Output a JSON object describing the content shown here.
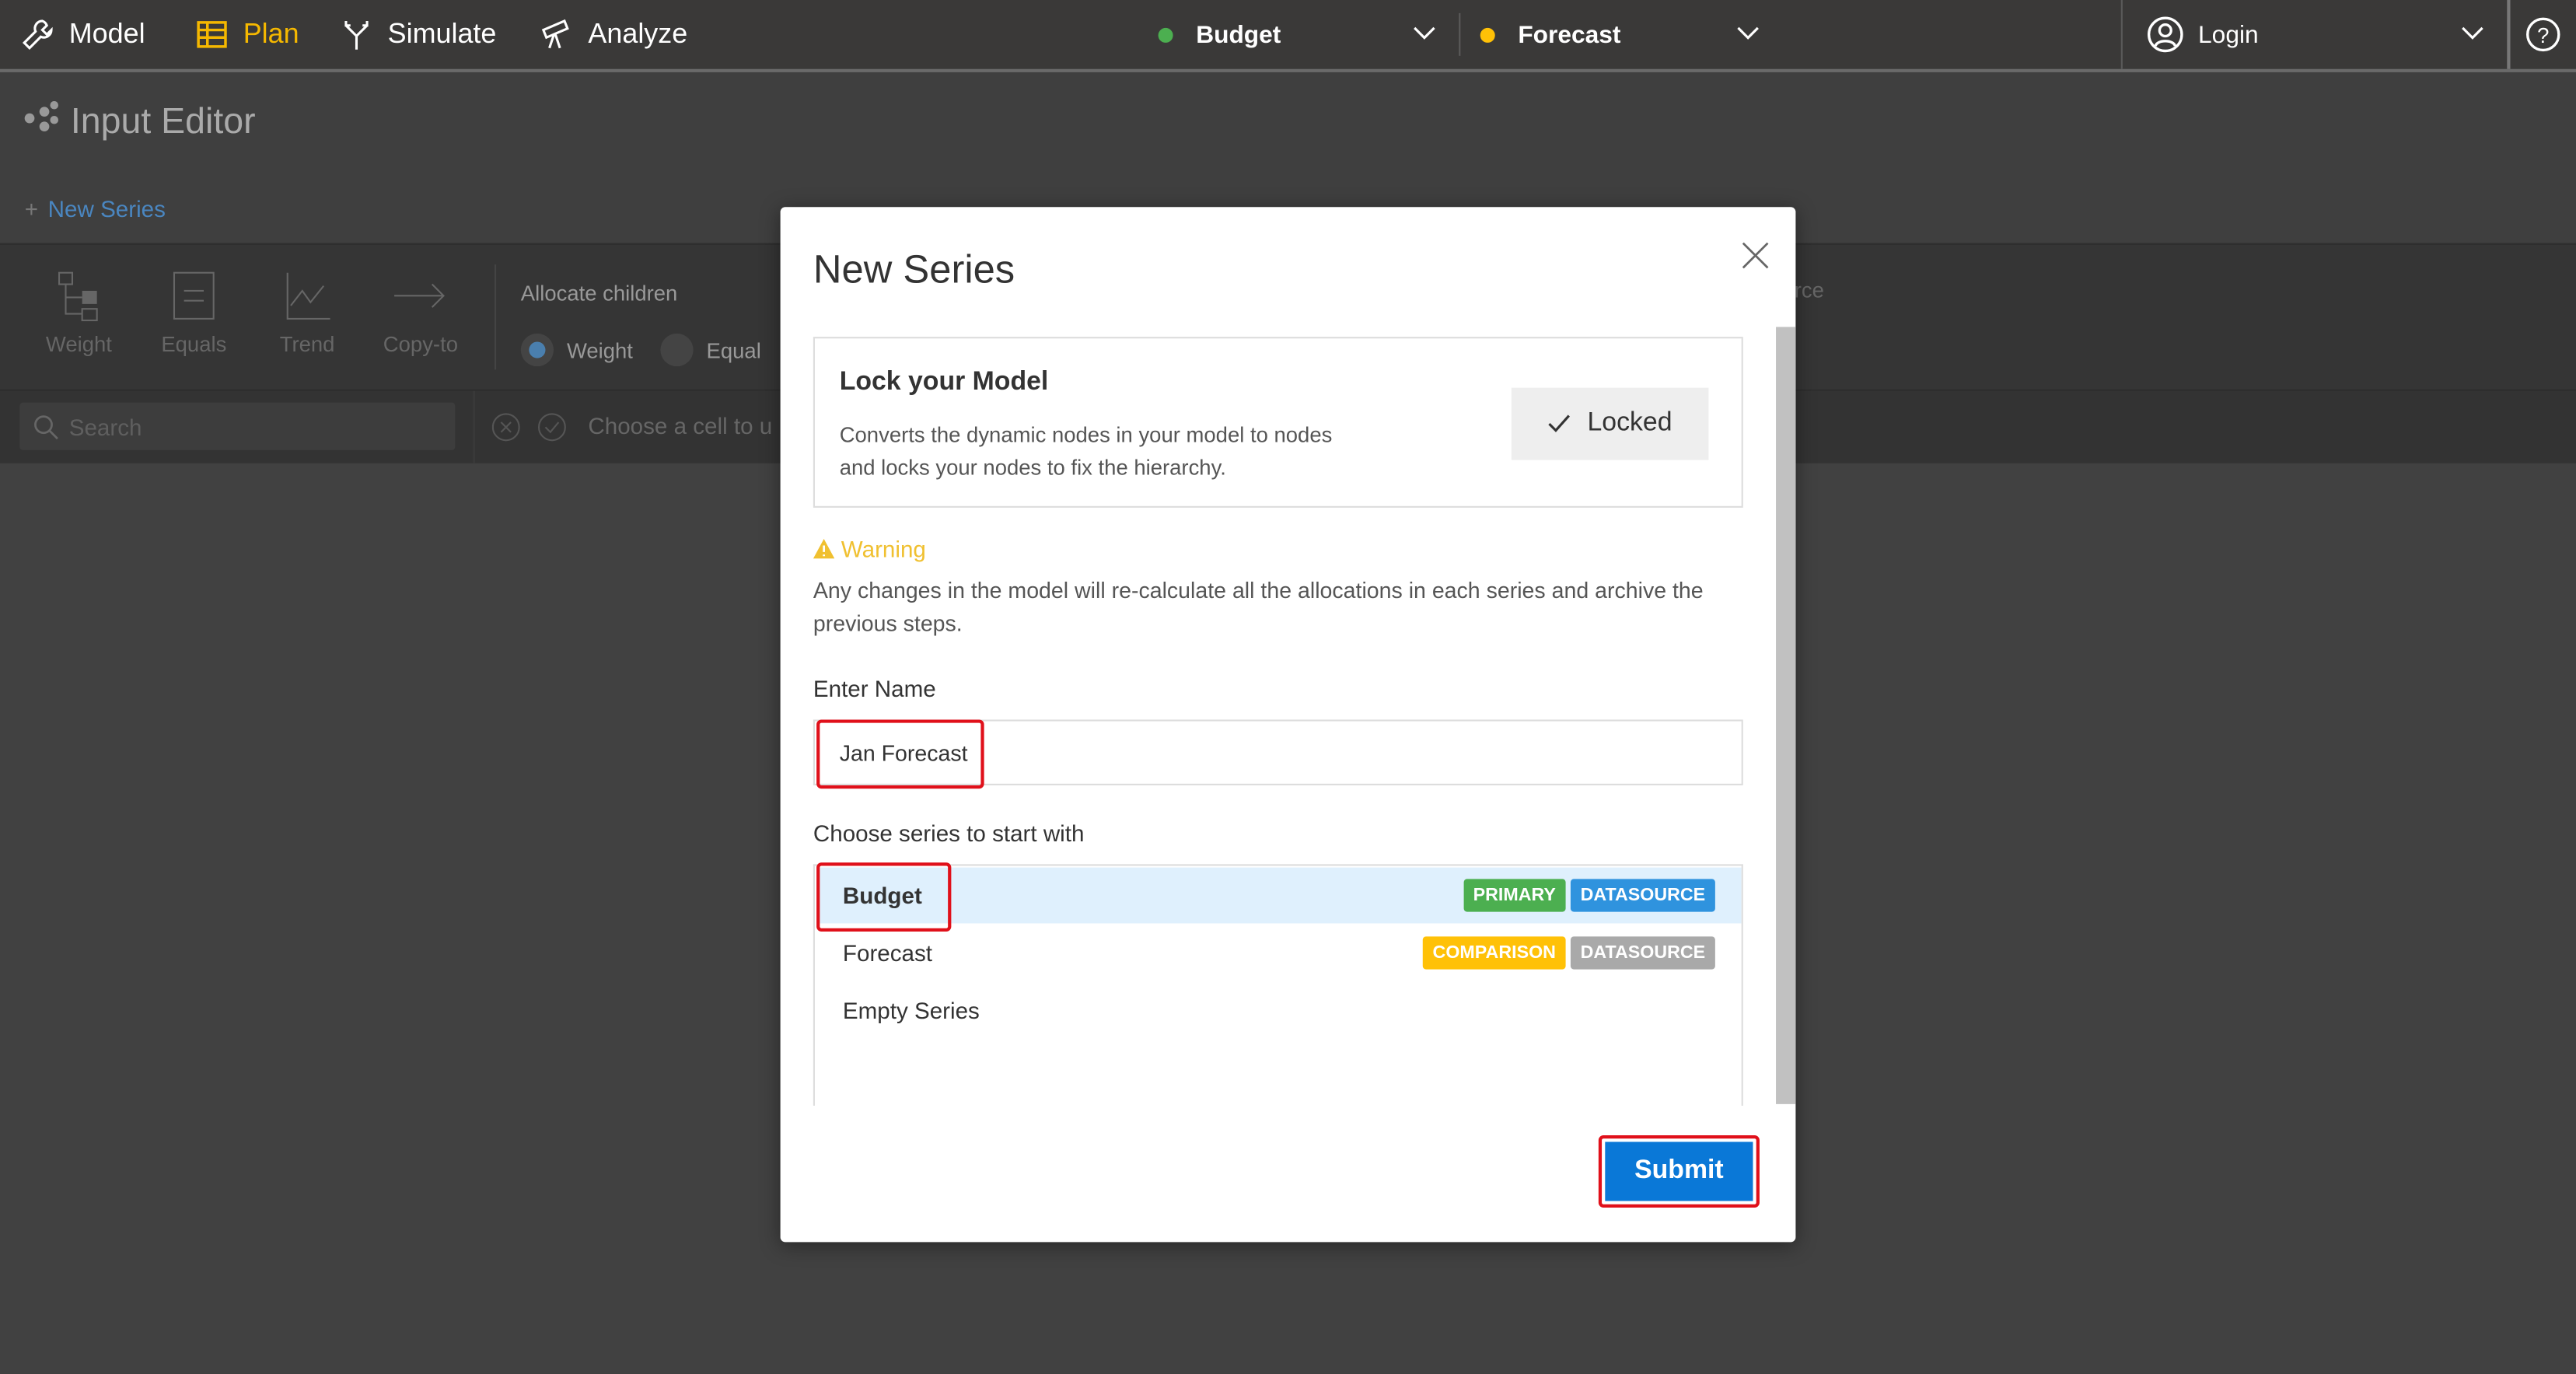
{
  "topbar": {
    "nav": [
      {
        "label": "Model",
        "icon": "wrench-icon",
        "active": false
      },
      {
        "label": "Plan",
        "icon": "table-icon",
        "active": true
      },
      {
        "label": "Simulate",
        "icon": "fork-arrows-icon",
        "active": false
      },
      {
        "label": "Analyze",
        "icon": "telescope-icon",
        "active": false
      }
    ],
    "series_selectors": [
      {
        "label": "Budget",
        "color": "#4caf50"
      },
      {
        "label": "Forecast",
        "color": "#ffc107"
      }
    ],
    "login_label": "Login",
    "active_color": "#f5b800"
  },
  "page": {
    "title": "Input Editor",
    "new_series_link": "New Series"
  },
  "toolbar": {
    "tools": [
      "Weight",
      "Equals",
      "Trend",
      "Copy-to"
    ],
    "allocate_label": "Allocate children",
    "allocate_options": [
      {
        "label": "Weight",
        "selected": true
      },
      {
        "label": "Equal",
        "selected": false
      }
    ],
    "right_partial_text": "urce"
  },
  "searchbar": {
    "placeholder": "Search",
    "cell_hint": "Choose a cell to u"
  },
  "modal": {
    "title": "New Series",
    "lock": {
      "title": "Lock your Model",
      "description_line1": "Converts the dynamic nodes in your model to nodes",
      "description_line2": "and locks your nodes to fix the hierarchy.",
      "button_label": "Locked"
    },
    "warning_title": "Warning",
    "warning_text_line1": "Any changes in the model will re-calculate all the allocations in each series and archive the",
    "warning_text_line2": "previous steps.",
    "name_label": "Enter Name",
    "name_value": "Jan Forecast",
    "series_label": "Choose series to start with",
    "series": [
      {
        "name": "Budget",
        "selected": true,
        "badges": [
          {
            "text": "PRIMARY",
            "color": "#4caf50"
          },
          {
            "text": "DATASOURCE",
            "color": "#2f93de"
          }
        ]
      },
      {
        "name": "Forecast",
        "selected": false,
        "badges": [
          {
            "text": "COMPARISON",
            "color": "#ffc107"
          },
          {
            "text": "DATASOURCE",
            "color": "#a9a9a9"
          }
        ]
      },
      {
        "name": "Empty Series",
        "selected": false,
        "badges": []
      }
    ],
    "submit_label": "Submit"
  }
}
